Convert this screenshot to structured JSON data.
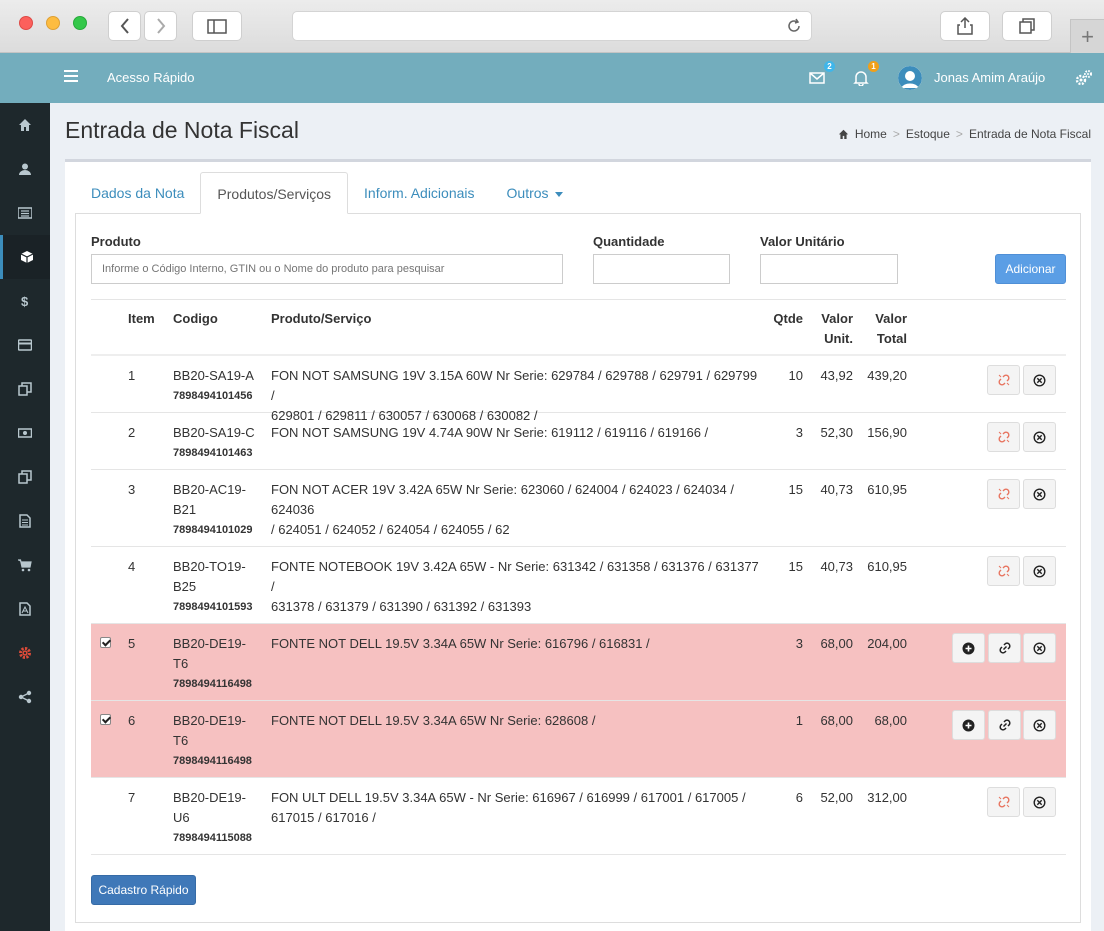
{
  "browser": {
    "url": ""
  },
  "topnav": {
    "quick_access": "Acesso Rápido",
    "mail_count": "2",
    "notif_count": "1",
    "user_name": "Jonas Amim Araújo"
  },
  "page": {
    "title": "Entrada de Nota Fiscal",
    "breadcrumb": [
      "Home",
      "Estoque",
      "Entrada de Nota Fiscal"
    ]
  },
  "tabs": [
    "Dados da Nota",
    "Produtos/Serviços",
    "Inform. Adicionais",
    "Outros"
  ],
  "form": {
    "produto_label": "Produto",
    "produto_placeholder": "Informe o Código Interno, GTIN ou o Nome do produto para pesquisar",
    "quantidade_label": "Quantidade",
    "valor_label": "Valor Unitário",
    "add_button": "Adicionar"
  },
  "table": {
    "headers": {
      "item": "Item",
      "codigo": "Codigo",
      "produto": "Produto/Serviço",
      "qtde": "Qtde",
      "valor_unit_1": "Valor",
      "valor_unit_2": "Unit.",
      "valor_total_1": "Valor",
      "valor_total_2": "Total"
    },
    "rows": [
      {
        "item": "1",
        "code_1": "BB20-SA19-A",
        "code_2": "",
        "gtin": "7898494101456",
        "desc_1": "FON NOT SAMSUNG 19V 3.15A 60W Nr Serie: 629784 / 629788 / 629791 / 629799 /",
        "desc_2": "629801 / 629811 / 630057 / 630068 / 630082 /",
        "qtde": "10",
        "unit": "43,92",
        "total": "439,20",
        "selected": false
      },
      {
        "item": "2",
        "code_1": "BB20-SA19-C",
        "code_2": "",
        "gtin": "7898494101463",
        "desc_1": "FON NOT SAMSUNG 19V 4.74A 90W Nr Serie: 619112 / 619116 / 619166 /",
        "desc_2": "",
        "qtde": "3",
        "unit": "52,30",
        "total": "156,90",
        "selected": false
      },
      {
        "item": "3",
        "code_1": "BB20-AC19-",
        "code_2": "B21",
        "gtin": "7898494101029",
        "desc_1": "FON NOT ACER 19V 3.42A 65W Nr Serie: 623060 / 624004 / 624023 / 624034 / 624036",
        "desc_2": "/ 624051 / 624052 / 624054 / 624055 / 62",
        "qtde": "15",
        "unit": "40,73",
        "total": "610,95",
        "selected": false
      },
      {
        "item": "4",
        "code_1": "BB20-TO19-",
        "code_2": "B25",
        "gtin": "7898494101593",
        "desc_1": "FONTE NOTEBOOK 19V 3.42A 65W - Nr Serie: 631342 / 631358 / 631376 / 631377 /",
        "desc_2": "631378 / 631379 / 631390 / 631392 / 631393",
        "qtde": "15",
        "unit": "40,73",
        "total": "610,95",
        "selected": false
      },
      {
        "item": "5",
        "code_1": "BB20-DE19-",
        "code_2": "T6",
        "gtin": "7898494116498",
        "desc_1": "FONTE NOT DELL 19.5V 3.34A 65W Nr Serie: 616796 / 616831 /",
        "desc_2": "",
        "qtde": "3",
        "unit": "68,00",
        "total": "204,00",
        "selected": true
      },
      {
        "item": "6",
        "code_1": "BB20-DE19-",
        "code_2": "T6",
        "gtin": "7898494116498",
        "desc_1": "FONTE NOT DELL 19.5V 3.34A 65W Nr Serie: 628608 /",
        "desc_2": "",
        "qtde": "1",
        "unit": "68,00",
        "total": "68,00",
        "selected": true
      },
      {
        "item": "7",
        "code_1": "BB20-DE19-",
        "code_2": "U6",
        "gtin": "7898494115088",
        "desc_1": "FON ULT DELL 19.5V 3.34A 65W - Nr Serie: 616967 / 616999 / 617001 / 617005 /",
        "desc_2": "617015 / 617016 /",
        "qtde": "6",
        "unit": "52,00",
        "total": "312,00",
        "selected": false
      }
    ]
  },
  "cadastro_button": "Cadastro Rápido",
  "colors": {
    "nav": "#73adbd",
    "sidebar": "#1e282c",
    "selected_row": "#f6c1c1",
    "primary": "#3f78b8"
  }
}
